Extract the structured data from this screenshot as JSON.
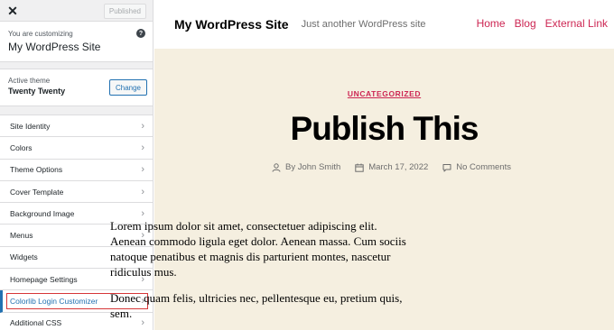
{
  "customizer": {
    "close_icon": "close-icon",
    "published_label": "Published",
    "customizing_label": "You are customizing",
    "site_name": "My WordPress Site",
    "help_icon": "help-icon",
    "active_theme_label": "Active theme",
    "active_theme_name": "Twenty Twenty",
    "change_label": "Change",
    "menu_items": [
      {
        "label": "Site Identity"
      },
      {
        "label": "Colors"
      },
      {
        "label": "Theme Options"
      },
      {
        "label": "Cover Template"
      },
      {
        "label": "Background Image"
      },
      {
        "label": "Menus"
      },
      {
        "label": "Widgets"
      },
      {
        "label": "Homepage Settings"
      },
      {
        "label": "Colorlib Login Customizer"
      },
      {
        "label": "Additional CSS"
      }
    ],
    "highlighted_item": "Colorlib Login Customizer"
  },
  "site": {
    "title": "My WordPress Site",
    "tagline": "Just another WordPress site",
    "nav": [
      "Home",
      "Blog",
      "External Link"
    ]
  },
  "post": {
    "category": "UNCATEGORIZED",
    "title": "Publish This",
    "author": "By John Smith",
    "date": "March 17, 2022",
    "comments": "No Comments",
    "paragraphs": [
      "Lorem ipsum dolor sit amet, consectetuer adipiscing elit. Aenean commodo ligula eget dolor. Aenean massa. Cum sociis natoque penatibus et magnis dis parturient montes, nascetur ridiculus mus.",
      "Donec quam felis, ultricies nec, pellentesque eu, pretium quis, sem."
    ]
  },
  "colors": {
    "accent": "#cd2653",
    "wp_blue": "#2271b1",
    "preview_bg": "#f5efe0",
    "highlight_border": "#d63638"
  }
}
